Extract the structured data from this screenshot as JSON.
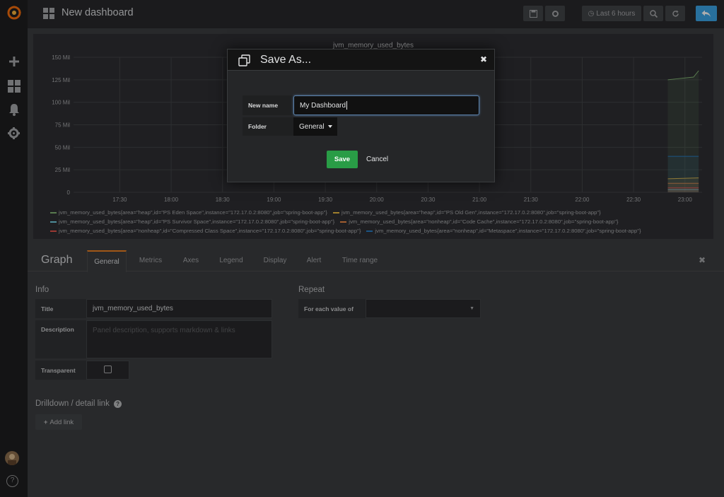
{
  "navbar": {
    "title": "New dashboard",
    "time_range_label": "Last 6 hours"
  },
  "panel": {
    "title": "jvm_memory_used_bytes",
    "legend": [
      [
        {
          "label": "jvm_memory_used_bytes{area=\"heap\",id=\"PS Eden Space\",instance=\"172.17.0.2:8080\",job=\"spring-boot-app\"}",
          "color": "#7eb26d"
        },
        {
          "label": "jvm_memory_used_bytes{area=\"heap\",id=\"PS Old Gen\",instance=\"172.17.0.2:8080\",job=\"spring-boot-app\"}",
          "color": "#eab839"
        }
      ],
      [
        {
          "label": "jvm_memory_used_bytes{area=\"heap\",id=\"PS Survivor Space\",instance=\"172.17.0.2:8080\",job=\"spring-boot-app\"}",
          "color": "#6ed0e0"
        },
        {
          "label": "jvm_memory_used_bytes{area=\"nonheap\",id=\"Code Cache\",instance=\"172.17.0.2:8080\",job=\"spring-boot-app\"}",
          "color": "#ef843c"
        }
      ],
      [
        {
          "label": "jvm_memory_used_bytes{area=\"nonheap\",id=\"Compressed Class Space\",instance=\"172.17.0.2:8080\",job=\"spring-boot-app\"}",
          "color": "#e24d42"
        },
        {
          "label": "jvm_memory_used_bytes{area=\"nonheap\",id=\"Metaspace\",instance=\"172.17.0.2:8080\",job=\"spring-boot-app\"}",
          "color": "#1f78c1"
        }
      ]
    ]
  },
  "edit": {
    "title": "Graph",
    "tabs": [
      "General",
      "Metrics",
      "Axes",
      "Legend",
      "Display",
      "Alert",
      "Time range"
    ],
    "info_heading": "Info",
    "title_label": "Title",
    "title_value": "jvm_memory_used_bytes",
    "description_label": "Description",
    "description_placeholder": "Panel description, supports markdown & links",
    "transparent_label": "Transparent",
    "repeat_heading": "Repeat",
    "repeat_label": "For each value of",
    "drilldown_heading": "Drilldown / detail link",
    "add_link_label": "Add link"
  },
  "modal": {
    "title": "Save As...",
    "name_label": "New name",
    "name_value": "My Dashboard",
    "folder_label": "Folder",
    "folder_value": "General",
    "save_label": "Save",
    "cancel_label": "Cancel"
  },
  "chart_data": {
    "type": "line",
    "title": "jvm_memory_used_bytes",
    "y_ticks": [
      "0",
      "25 Mil",
      "50 Mil",
      "75 Mil",
      "100 Mil",
      "125 Mil",
      "150 Mil"
    ],
    "x_ticks": [
      "17:30",
      "18:00",
      "18:30",
      "19:00",
      "19:30",
      "20:00",
      "20:30",
      "21:00",
      "21:30",
      "22:00",
      "22:30",
      "23:00"
    ],
    "ylim": [
      0,
      150
    ],
    "y_unit": "Mil",
    "x_start": "17:03",
    "x_end": "23:10",
    "series": [
      {
        "name": "jvm_memory_used_bytes{area=\"heap\",id=\"PS Eden Space\",instance=\"172.17.0.2:8080\",job=\"spring-boot-app\"}",
        "color": "#7eb26d",
        "x": [
          "22:50",
          "22:55",
          "23:00",
          "23:05",
          "23:08"
        ],
        "values": [
          125,
          126,
          127,
          128,
          135
        ]
      },
      {
        "name": "jvm_memory_used_bytes{area=\"heap\",id=\"PS Old Gen\",instance=\"172.17.0.2:8080\",job=\"spring-boot-app\"}",
        "color": "#eab839",
        "x": [
          "22:50",
          "23:08"
        ],
        "values": [
          15,
          16
        ]
      },
      {
        "name": "jvm_memory_used_bytes{area=\"heap\",id=\"PS Survivor Space\",instance=\"172.17.0.2:8080\",job=\"spring-boot-app\"}",
        "color": "#6ed0e0",
        "x": [
          "22:50",
          "23:08"
        ],
        "values": [
          3,
          3
        ]
      },
      {
        "name": "jvm_memory_used_bytes{area=\"nonheap\",id=\"Code Cache\",instance=\"172.17.0.2:8080\",job=\"spring-boot-app\"}",
        "color": "#ef843c",
        "x": [
          "22:50",
          "23:08"
        ],
        "values": [
          10,
          10
        ]
      },
      {
        "name": "jvm_memory_used_bytes{area=\"nonheap\",id=\"Compressed Class Space\",instance=\"172.17.0.2:8080\",job=\"spring-boot-app\"}",
        "color": "#e24d42",
        "x": [
          "22:50",
          "23:08"
        ],
        "values": [
          5,
          5
        ]
      },
      {
        "name": "jvm_memory_used_bytes{area=\"nonheap\",id=\"Metaspace\",instance=\"172.17.0.2:8080\",job=\"spring-boot-app\"}",
        "color": "#1f78c1",
        "x": [
          "22:50",
          "23:08"
        ],
        "values": [
          40,
          40
        ]
      }
    ]
  }
}
